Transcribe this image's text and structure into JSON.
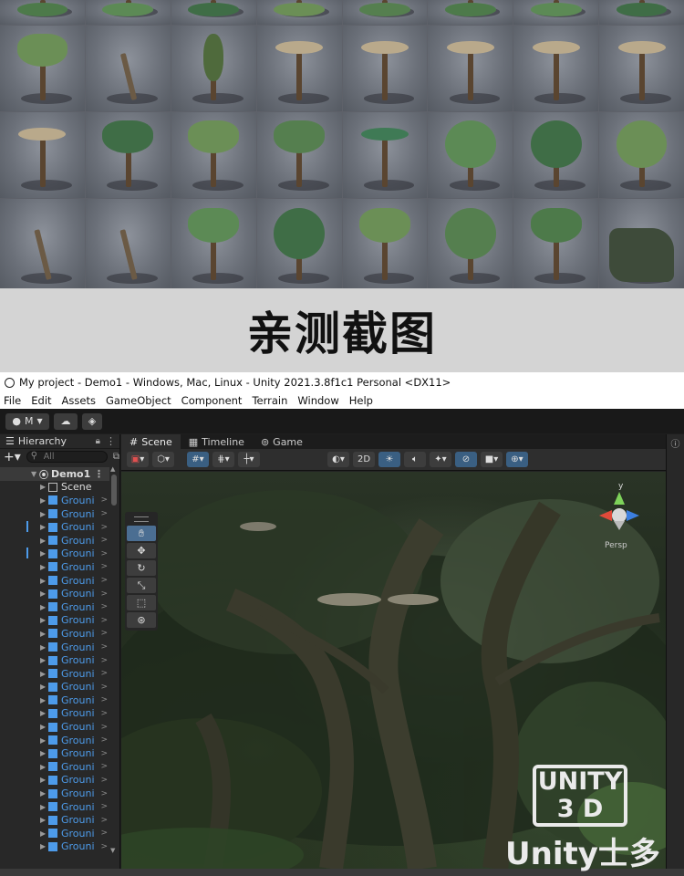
{
  "caption": "亲测截图",
  "window_title": "My project - Demo1 - Windows, Mac, Linux - Unity 2021.3.8f1c1 Personal <DX11>",
  "menu": [
    "File",
    "Edit",
    "Assets",
    "GameObject",
    "Component",
    "Terrain",
    "Window",
    "Help"
  ],
  "toolbar": {
    "account": "M",
    "cloud_icon": "cloud-icon",
    "collab_icon": "collab-icon"
  },
  "hierarchy": {
    "tab": "Hierarchy",
    "search_placeholder": "All",
    "root": "Demo1",
    "items": [
      "Scene",
      "Grouni",
      "Grouni",
      "Grouni",
      "Grouni",
      "Grouni",
      "Grouni",
      "Grouni",
      "Grouni",
      "Grouni",
      "Grouni",
      "Grouni",
      "Grouni",
      "Grouni",
      "Grouni",
      "Grouni",
      "Grouni",
      "Grouni",
      "Grouni",
      "Grouni",
      "Grouni",
      "Grouni",
      "Grouni",
      "Grouni",
      "Grouni",
      "Grouni",
      "Grouni",
      "Grouni"
    ]
  },
  "scene_tabs": [
    "Scene",
    "Timeline",
    "Game"
  ],
  "scene_toolbar": {
    "mode_2d": "2D"
  },
  "gizmo": {
    "axis_y": "y",
    "persp": "Persp"
  },
  "watermark": {
    "line1": "UNITY",
    "line2": "3 D",
    "brand": "Unity士多"
  },
  "colors": {
    "accent": "#4d9bea",
    "panel": "#282828",
    "caption_bg": "#d4d4d4"
  }
}
